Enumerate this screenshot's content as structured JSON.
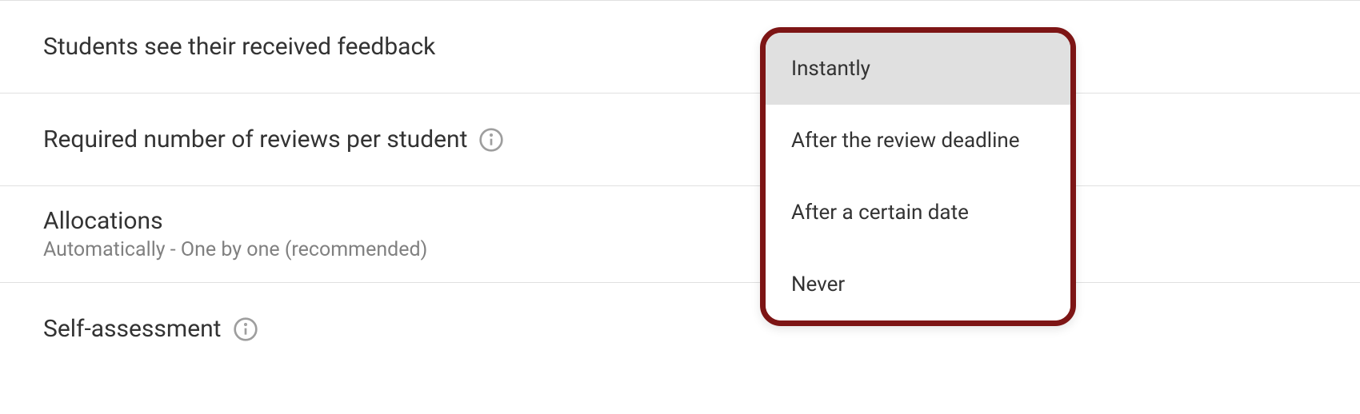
{
  "rows": {
    "feedback": {
      "label": "Students see their received feedback"
    },
    "reviews": {
      "label": "Required number of reviews per student"
    },
    "allocations": {
      "label": "Allocations",
      "sub": "Automatically - One by one (recommended)"
    },
    "self": {
      "label": "Self-assessment"
    }
  },
  "dropdown": {
    "options": [
      "Instantly",
      "After the review deadline",
      "After a certain date",
      "Never"
    ]
  }
}
